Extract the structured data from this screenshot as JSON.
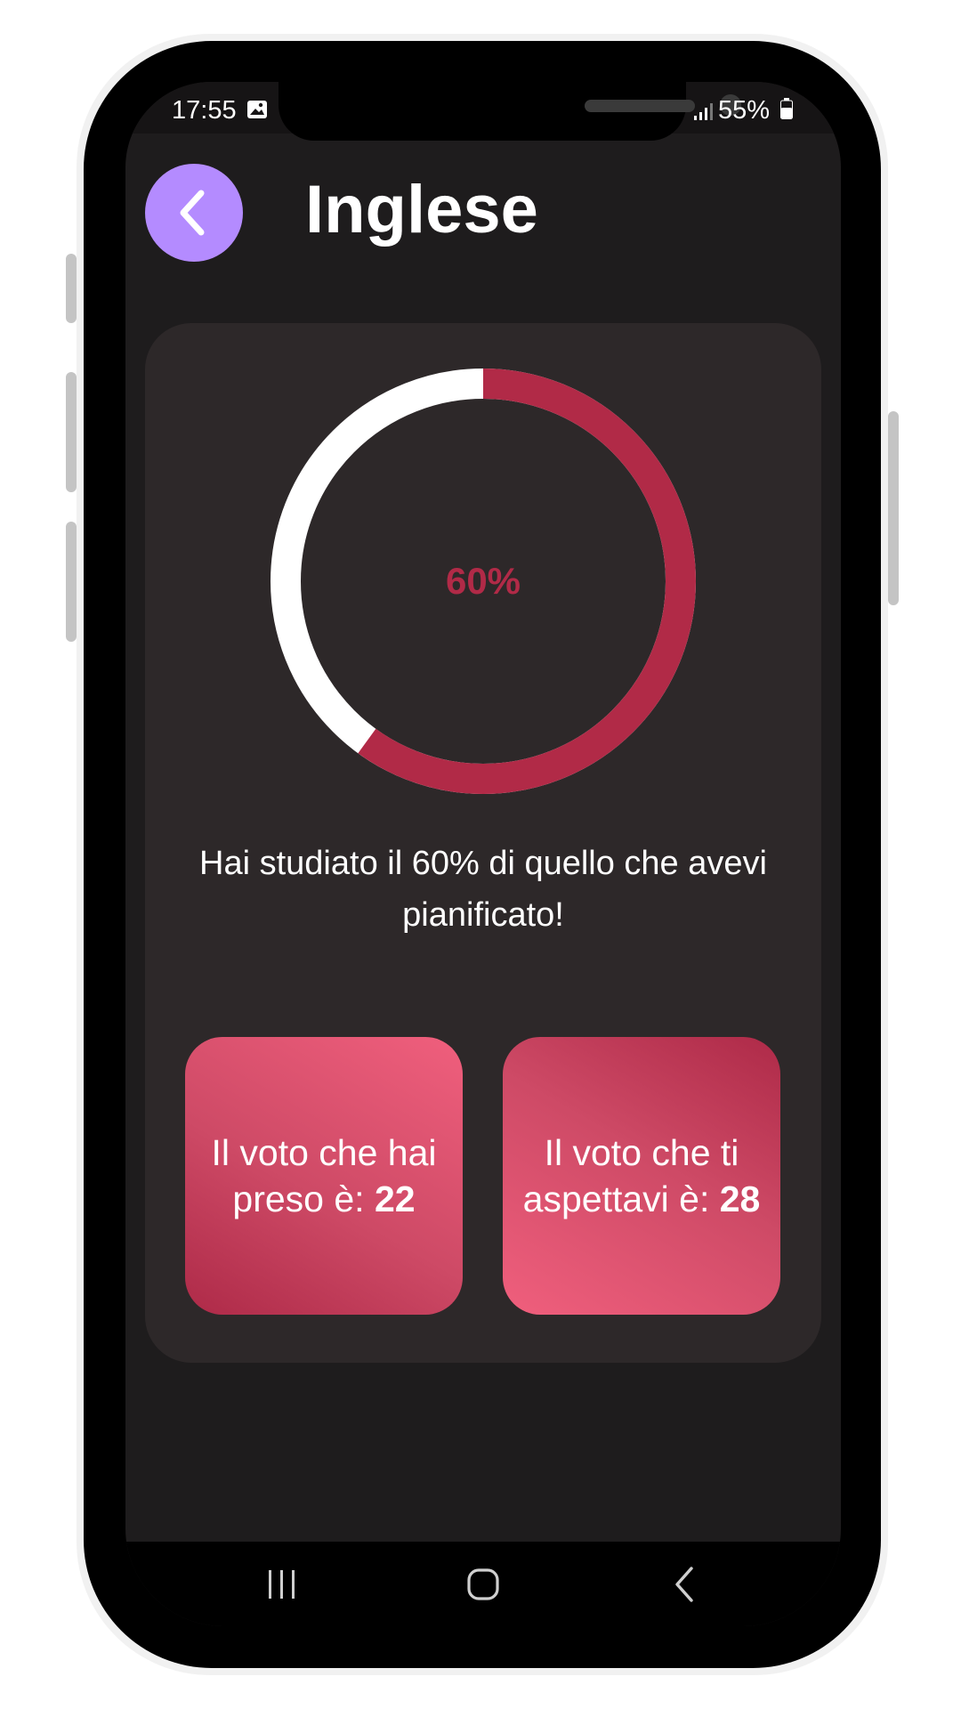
{
  "status_bar": {
    "time": "17:55",
    "battery": "55%",
    "icons": [
      "image-icon",
      "signal-icon",
      "battery-icon"
    ]
  },
  "header": {
    "title": "Inglese",
    "back_icon": "chevron-left-icon"
  },
  "progress": {
    "percent_label": "60%",
    "value": 0.6,
    "message": "Hai studiato il 60% di quello che avevi pianificato!"
  },
  "grades": {
    "obtained_text": "Il voto che hai preso è: ",
    "obtained_value": "22",
    "expected_text": "Il voto che ti aspettavi è: ",
    "expected_value": "28"
  },
  "nav": {
    "icons": [
      "recent-apps-icon",
      "home-icon",
      "back-nav-icon"
    ]
  },
  "colors": {
    "accent_purple": "#b48bff",
    "progress_red": "#b12a47",
    "ring_rest": "#ffffff",
    "card_bg": "#2d2829",
    "screen_bg": "#1e1c1d"
  }
}
